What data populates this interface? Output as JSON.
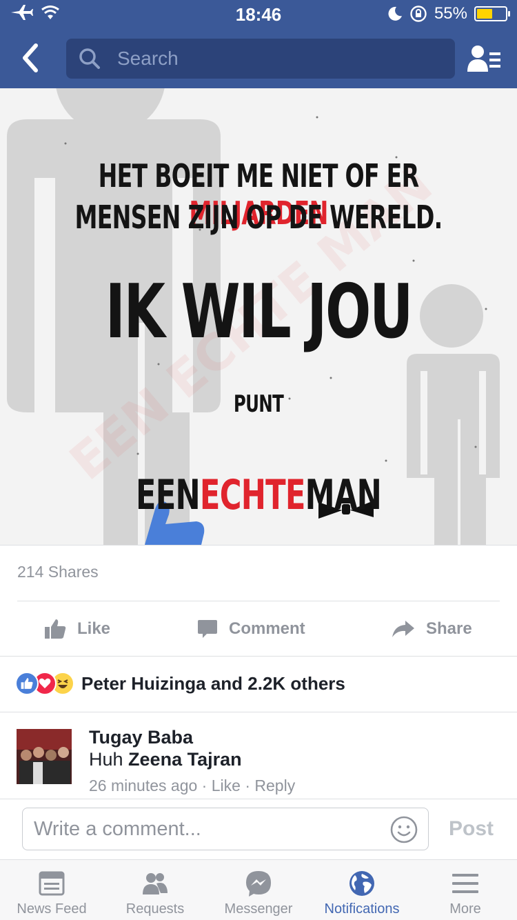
{
  "status_bar": {
    "time": "18:46",
    "battery_percent_label": "55%",
    "battery_level": 0.55,
    "icons": [
      "airplane-icon",
      "wifi-icon",
      "moon-icon",
      "rotation-lock-icon",
      "battery-icon"
    ]
  },
  "nav": {
    "search_placeholder": "Search",
    "icons": [
      "back-chevron-icon",
      "search-icon",
      "friends-list-icon"
    ],
    "color": "#3b5998"
  },
  "post_image": {
    "line1_part1": "HET BOEIT ME NIET OF ER ",
    "line1_highlight": "MILJARDEN",
    "line2": "MENSEN ZIJN OP DE WERELD.",
    "headline": "IK WIL JOU",
    "subline": "PUNT",
    "brand_part1": "EEN",
    "brand_highlight": "ECHTE",
    "brand_part2": "MAN",
    "watermark": "EEN ECHTE MAN",
    "accent_color": "#e0242d"
  },
  "shares": "214 Shares",
  "actions": {
    "like": "Like",
    "comment": "Comment",
    "share": "Share"
  },
  "reactions": {
    "icons": [
      "like-reaction-icon",
      "love-reaction-icon",
      "haha-reaction-icon"
    ],
    "text": "Peter Huizinga and 2.2K others"
  },
  "comment": {
    "author": "Tugay Baba",
    "text_prefix": "Huh ",
    "tagged_name": "Zeena Tajran",
    "time": "26 minutes ago",
    "sep1": " · ",
    "like": "Like",
    "sep2": " · ",
    "reply": "Reply"
  },
  "write_comment": {
    "placeholder": "Write a comment...",
    "post_label": "Post"
  },
  "tabs": [
    {
      "label": "News Feed",
      "icon": "news-feed-icon",
      "active": false
    },
    {
      "label": "Requests",
      "icon": "requests-icon",
      "active": false
    },
    {
      "label": "Messenger",
      "icon": "messenger-icon",
      "active": false
    },
    {
      "label": "Notifications",
      "icon": "globe-icon",
      "active": true
    },
    {
      "label": "More",
      "icon": "menu-icon",
      "active": false
    }
  ]
}
